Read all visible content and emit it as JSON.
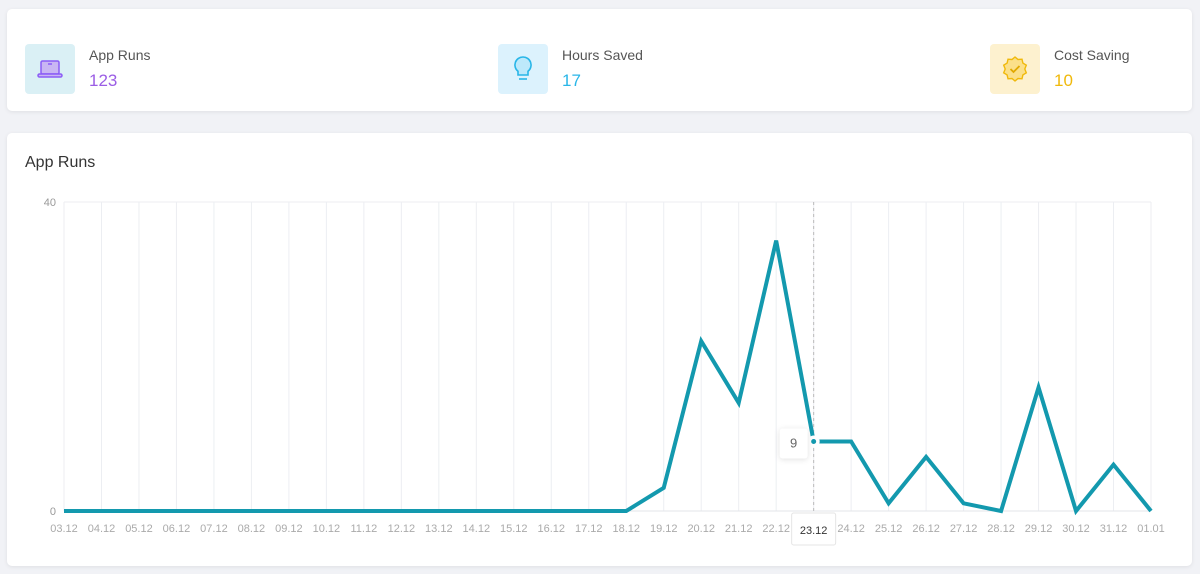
{
  "stats": [
    {
      "label": "App Runs",
      "value": "123",
      "icon": "laptop-icon",
      "color": "#9b5de5",
      "bg": "#daf0f5"
    },
    {
      "label": "Hours Saved",
      "value": "17",
      "icon": "lightbulb-icon",
      "color": "#29b6e8",
      "bg": "#dcf2fd"
    },
    {
      "label": "Cost Saving",
      "value": "10",
      "icon": "badge-check-icon",
      "color": "#f0b90b",
      "bg": "#fdf1cf"
    }
  ],
  "chart_data": {
    "type": "line",
    "title": "App Runs",
    "categories": [
      "03.12",
      "04.12",
      "05.12",
      "06.12",
      "07.12",
      "08.12",
      "09.12",
      "10.12",
      "11.12",
      "12.12",
      "13.12",
      "14.12",
      "15.12",
      "16.12",
      "17.12",
      "18.12",
      "19.12",
      "20.12",
      "21.12",
      "22.12",
      "23.12",
      "24.12",
      "25.12",
      "26.12",
      "27.12",
      "28.12",
      "29.12",
      "30.12",
      "31.12",
      "01.01"
    ],
    "values": [
      0,
      0,
      0,
      0,
      0,
      0,
      0,
      0,
      0,
      0,
      0,
      0,
      0,
      0,
      0,
      0,
      3,
      22,
      14,
      35,
      9,
      9,
      1,
      7,
      1,
      0,
      16,
      0,
      6,
      0
    ],
    "ylim": [
      0,
      40
    ],
    "yticks": [
      "0",
      "40"
    ],
    "grid": "vertical",
    "color": "#1399ae",
    "tooltip": {
      "category": "23.12",
      "value": "9"
    }
  }
}
